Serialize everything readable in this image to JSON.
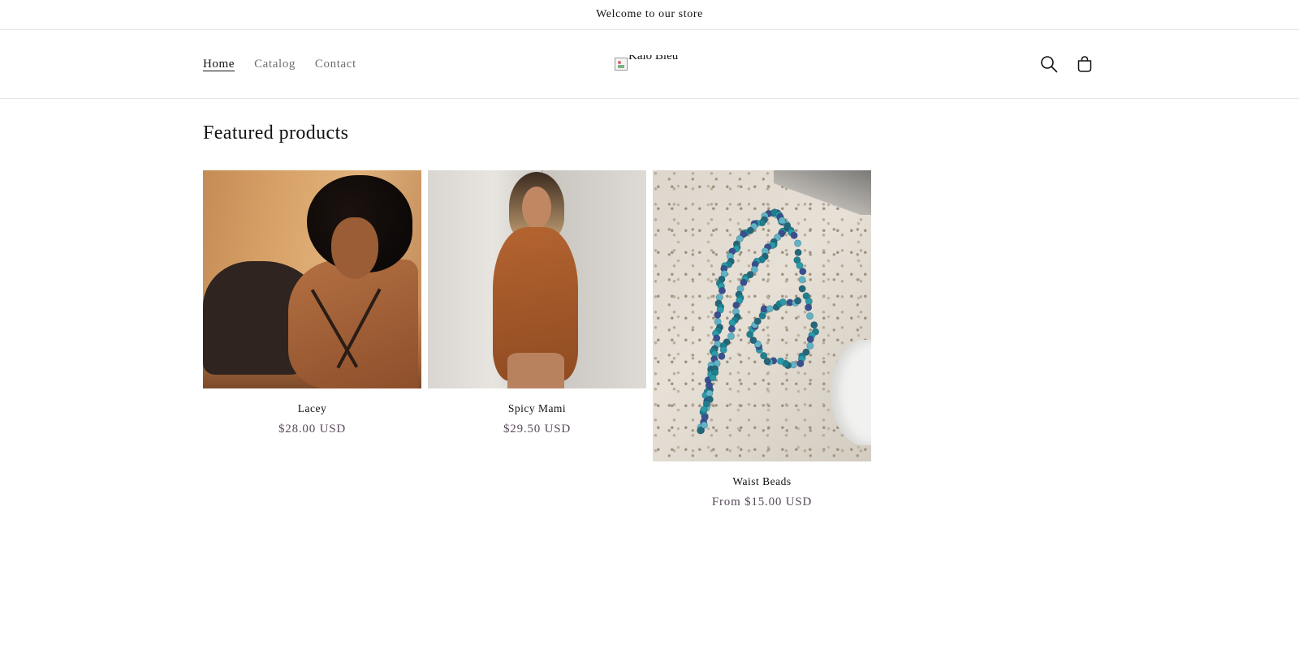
{
  "announcement": {
    "text": "Welcome to our store"
  },
  "header": {
    "nav": [
      {
        "label": "Home",
        "active": true
      },
      {
        "label": "Catalog",
        "active": false
      },
      {
        "label": "Contact",
        "active": false
      }
    ],
    "logo_alt": "Kalo Bleu",
    "icons": [
      "search-icon",
      "cart-icon"
    ]
  },
  "featured": {
    "title": "Featured products",
    "products": [
      {
        "title": "Lacey",
        "price": "$28.00 USD",
        "image": "woman-in-brown-dress-photo"
      },
      {
        "title": "Spicy Mami",
        "price": "$29.50 USD",
        "image": "woman-in-rust-outfit-photo"
      },
      {
        "title": "Waist Beads",
        "price": "From $15.00 USD",
        "image": "blue-waist-beads-photo"
      }
    ]
  },
  "colors": {
    "text": "#121212",
    "muted_nav": "#6e6e6e",
    "price": "#5a4a5a",
    "divider": "#e6e6e6"
  }
}
